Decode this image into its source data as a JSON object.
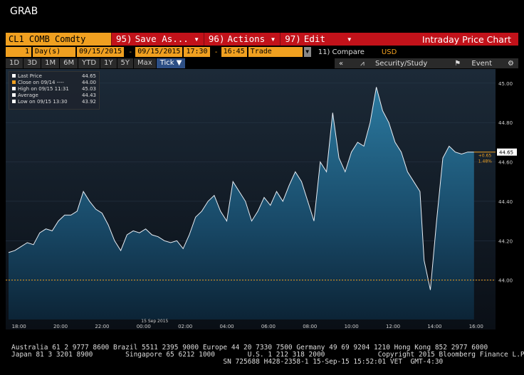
{
  "window": {
    "title": "GRAB"
  },
  "toolbar": {
    "ticker": "CL1 COMB Comdty",
    "save_num": "95)",
    "save_label": "Save As...",
    "actions_num": "96)",
    "actions_label": "Actions",
    "edit_num": "97)",
    "edit_label": "Edit",
    "chart_title": "Intraday Price Chart"
  },
  "params": {
    "period_count": "1",
    "period_unit": "Day(s)",
    "start_date": "09/15/2015",
    "end_date": "09/15/2015",
    "start_time": "17:30",
    "end_time": "16:45",
    "field": "Trade",
    "compare_num": "11)",
    "compare_label": "Compare",
    "currency": "USD"
  },
  "ranges": [
    "1D",
    "3D",
    "1M",
    "6M",
    "YTD",
    "1Y",
    "5Y",
    "Max",
    "Tick"
  ],
  "active_range": "Tick",
  "right_tools": {
    "collapse": "«",
    "security_study": "Security/Study",
    "event": "Event"
  },
  "legend": [
    {
      "label": "Last Price",
      "value": "44.65",
      "color": "#ffffff"
    },
    {
      "label": "Close on 09/14 ----",
      "value": "44.00",
      "color": "#f0a020"
    },
    {
      "label": "High on 09/15 11:31",
      "value": "45.03",
      "color": "#ffffff"
    },
    {
      "label": "Average",
      "value": "44.43",
      "color": "#ffffff"
    },
    {
      "label": "Low on 09/15 13:30",
      "value": "43.92",
      "color": "#ffffff"
    }
  ],
  "labels": {
    "last": "44.65",
    "change": "+0.65",
    "change_pct": "1.48%",
    "date": "15 Sep 2015"
  },
  "footer": {
    "line1": "Australia 61 2 9777 8600 Brazil 5511 2395 9000 Europe 44 20 7330 7500 Germany 49 69 9204 1210 Hong Kong 852 2977 6000",
    "line2": "Japan 81 3 3201 8900        Singapore 65 6212 1000        U.S. 1 212 318 2000             Copyright 2015 Bloomberg Finance L.P.",
    "line3": "                                                    SN 725688 H428-2358-1 15-Sep-15 15:52:01 VET  GMT-4:30"
  },
  "chart_data": {
    "type": "area",
    "x_ticks": [
      "18:00",
      "20:00",
      "22:00",
      "00:00",
      "02:00",
      "04:00",
      "06:00",
      "08:00",
      "10:00",
      "12:00",
      "14:00",
      "16:00"
    ],
    "y_ticks": [
      "44.00",
      "44.20",
      "44.40",
      "44.60",
      "44.80",
      "45.00"
    ],
    "ylim": [
      43.8,
      45.05
    ],
    "prev_close": 44.0,
    "last": 44.65,
    "x_hours": [
      0,
      0.3,
      0.6,
      0.9,
      1.2,
      1.5,
      1.8,
      2.1,
      2.4,
      2.7,
      3.0,
      3.3,
      3.6,
      3.9,
      4.2,
      4.5,
      4.8,
      5.1,
      5.4,
      5.7,
      6.0,
      6.3,
      6.6,
      6.9,
      7.2,
      7.5,
      7.8,
      8.1,
      8.4,
      8.7,
      9.0,
      9.3,
      9.6,
      9.9,
      10.2,
      10.5,
      10.8,
      11.1,
      11.4,
      11.7,
      12.0,
      12.3,
      12.6,
      12.9,
      13.2,
      13.5,
      13.8,
      14.1,
      14.4,
      14.7,
      15.0,
      15.3,
      15.6,
      15.9,
      16.2,
      16.5,
      16.8,
      17.1,
      17.4,
      17.7,
      18.0,
      18.3,
      18.6,
      18.9,
      19.2,
      19.5,
      19.8,
      20.0,
      20.3,
      20.6,
      20.9,
      21.2,
      21.5,
      21.8,
      22.1,
      22.4
    ],
    "values": [
      44.14,
      44.15,
      44.17,
      44.19,
      44.18,
      44.24,
      44.26,
      44.25,
      44.3,
      44.33,
      44.33,
      44.35,
      44.45,
      44.4,
      44.36,
      44.34,
      44.28,
      44.2,
      44.15,
      44.23,
      44.25,
      44.24,
      44.26,
      44.23,
      44.22,
      44.2,
      44.19,
      44.2,
      44.16,
      44.23,
      44.32,
      44.35,
      44.4,
      44.43,
      44.35,
      44.3,
      44.5,
      44.45,
      44.4,
      44.3,
      44.35,
      44.42,
      44.38,
      44.45,
      44.4,
      44.48,
      44.55,
      44.5,
      44.4,
      44.3,
      44.6,
      44.55,
      44.85,
      44.62,
      44.55,
      44.65,
      44.7,
      44.68,
      44.8,
      44.98,
      44.86,
      44.8,
      44.7,
      44.65,
      44.55,
      44.5,
      44.45,
      44.1,
      43.95,
      44.3,
      44.62,
      44.68,
      44.65,
      44.64,
      44.65,
      44.65
    ]
  }
}
